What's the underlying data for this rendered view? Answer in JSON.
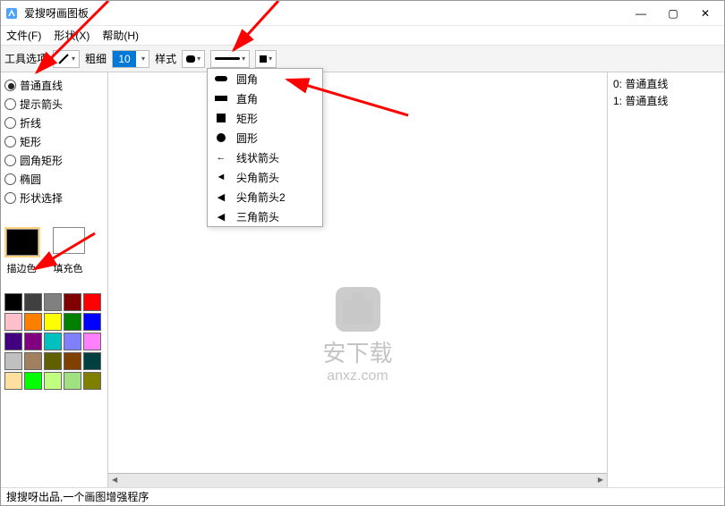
{
  "window": {
    "title": "爱搜呀画图板"
  },
  "menubar": {
    "file": "文件(F)",
    "shape": "形状(X)",
    "help": "帮助(H)"
  },
  "toolbar": {
    "tool_options": "工具选项",
    "thickness_label": "粗细",
    "thickness_value": "10",
    "style_label": "样式"
  },
  "shape_radios": {
    "items": [
      {
        "label": "普通直线"
      },
      {
        "label": "提示箭头"
      },
      {
        "label": "折线"
      },
      {
        "label": "矩形"
      },
      {
        "label": "圆角矩形"
      },
      {
        "label": "椭圆"
      },
      {
        "label": "形状选择"
      }
    ]
  },
  "color_section": {
    "stroke_label": "描边色",
    "fill_label": "填充色"
  },
  "palette_colors": [
    "#000000",
    "#404040",
    "#808080",
    "#800000",
    "#ff0000",
    "#ffc0cb",
    "#ff8000",
    "#ffff00",
    "#008000",
    "#0000ff",
    "#400080",
    "#800080",
    "#00c0c0",
    "#8080ff",
    "#ff80ff",
    "#c0c0c0",
    "#a08060",
    "#606000",
    "#804000",
    "#004040",
    "#ffe0a0",
    "#00ff00",
    "#c0ff80",
    "#a0e080",
    "#808000"
  ],
  "dropdown": {
    "items": [
      {
        "label": "圆角",
        "icon": "round"
      },
      {
        "label": "直角",
        "icon": "square"
      },
      {
        "label": "矩形",
        "icon": "rect"
      },
      {
        "label": "圆形",
        "icon": "circle"
      },
      {
        "label": "线状箭头",
        "icon": "arrow-line"
      },
      {
        "label": "尖角箭头",
        "icon": "arrow-sharp"
      },
      {
        "label": "尖角箭头2",
        "icon": "arrow-sharp2"
      },
      {
        "label": "三角箭头",
        "icon": "arrow-tri"
      }
    ]
  },
  "history": {
    "items": [
      {
        "label": "0: 普通直线"
      },
      {
        "label": "1: 普通直线"
      }
    ]
  },
  "watermark": {
    "line1": "安下载",
    "line2": "anxz.com"
  },
  "statusbar": {
    "text": "搜搜呀出品,一个画图增强程序"
  }
}
